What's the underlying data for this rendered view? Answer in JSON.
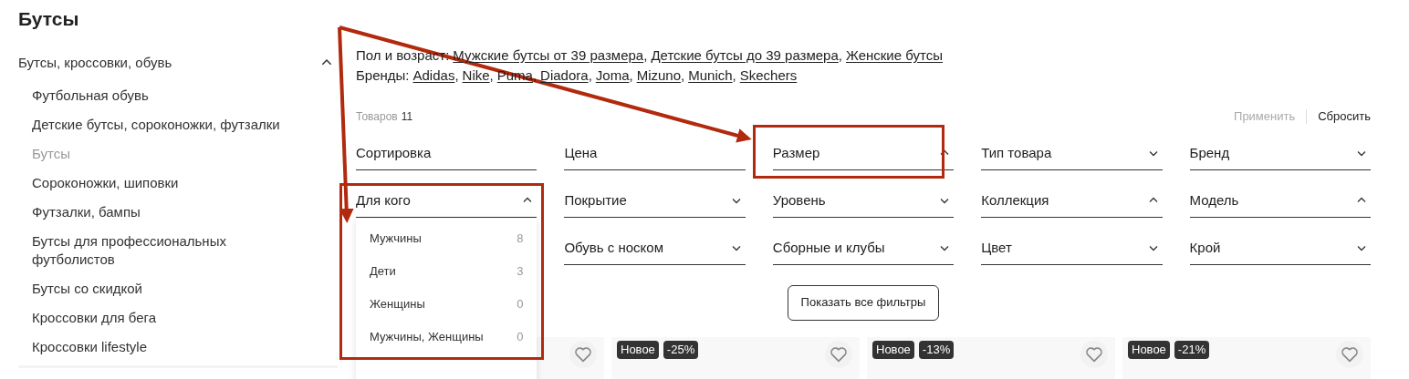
{
  "sidebar": {
    "title": "Бутсы",
    "category": {
      "label": "Бутсы, кроссовки, обувь",
      "expanded": true
    },
    "items": [
      {
        "label": "Футбольная обувь",
        "selected": false
      },
      {
        "label": "Детские бутсы, сороконожки, футзалки",
        "selected": false
      },
      {
        "label": "Бутсы",
        "selected": true
      },
      {
        "label": "Сороконожки, шиповки",
        "selected": false
      },
      {
        "label": "Футзалки, бампы",
        "selected": false
      },
      {
        "label": "Бутсы для профессиональных футболистов",
        "selected": false
      },
      {
        "label": "Бутсы со скидкой",
        "selected": false
      },
      {
        "label": "Кроссовки для бега",
        "selected": false
      },
      {
        "label": "Кроссовки lifestyle",
        "selected": false
      }
    ]
  },
  "link_groups": [
    {
      "label": "Пол и возраст:",
      "separator": ",",
      "links": [
        "Мужские бутсы от 39 размера",
        "Детские бутсы до 39 размера",
        "Женские бутсы"
      ]
    },
    {
      "label": "Бренды:",
      "separator": ",",
      "links": [
        "Adidas",
        "Nike",
        "Puma",
        "Diadora",
        "Joma",
        "Mizuno",
        "Munich",
        "Skechers"
      ]
    }
  ],
  "count": {
    "label": "Товаров",
    "value": "11"
  },
  "actions": [
    {
      "label": "Применить",
      "disabled": true
    },
    {
      "label": "Сбросить",
      "disabled": false
    }
  ],
  "filters": [
    {
      "label": "Сортировка",
      "kind": "plain",
      "highlighted": false
    },
    {
      "label": "Цена",
      "kind": "plain",
      "highlighted": false
    },
    {
      "label": "Размер",
      "kind": "select",
      "expanded": true,
      "highlighted": true
    },
    {
      "label": "Тип товара",
      "kind": "select",
      "expanded": false,
      "highlighted": false
    },
    {
      "label": "Бренд",
      "kind": "select",
      "expanded": false,
      "highlighted": false
    },
    {
      "label": "Для кого",
      "kind": "select",
      "expanded": true,
      "highlighted": true,
      "options": [
        {
          "label": "Мужчины",
          "count": "8"
        },
        {
          "label": "Дети",
          "count": "3"
        },
        {
          "label": "Женщины",
          "count": "0"
        },
        {
          "label": "Мужчины, Женщины",
          "count": "0"
        }
      ]
    },
    {
      "label": "Покрытие",
      "kind": "select",
      "expanded": false,
      "highlighted": false
    },
    {
      "label": "Уровень",
      "kind": "select",
      "expanded": false,
      "highlighted": false
    },
    {
      "label": "Коллекция",
      "kind": "select",
      "expanded": true,
      "highlighted": false
    },
    {
      "label": "Модель",
      "kind": "select",
      "expanded": true,
      "highlighted": false
    },
    {
      "label": "Обувь с носком",
      "kind": "select",
      "expanded": false,
      "highlighted": false
    },
    {
      "label": "Сборные и клубы",
      "kind": "select",
      "expanded": false,
      "highlighted": false
    },
    {
      "label": "Цвет",
      "kind": "select",
      "expanded": false,
      "highlighted": false
    },
    {
      "label": "Крой",
      "kind": "select",
      "expanded": false,
      "highlighted": false
    }
  ],
  "show_all_button": "Показать все фильтры",
  "products": [
    {
      "favorite": false
    },
    {
      "favorite": false,
      "badges": [
        "Новое",
        "-25%"
      ]
    },
    {
      "favorite": false,
      "badges": [
        "Новое",
        "-13%"
      ]
    },
    {
      "favorite": false,
      "badges": [
        "Новое",
        "-21%"
      ]
    }
  ]
}
